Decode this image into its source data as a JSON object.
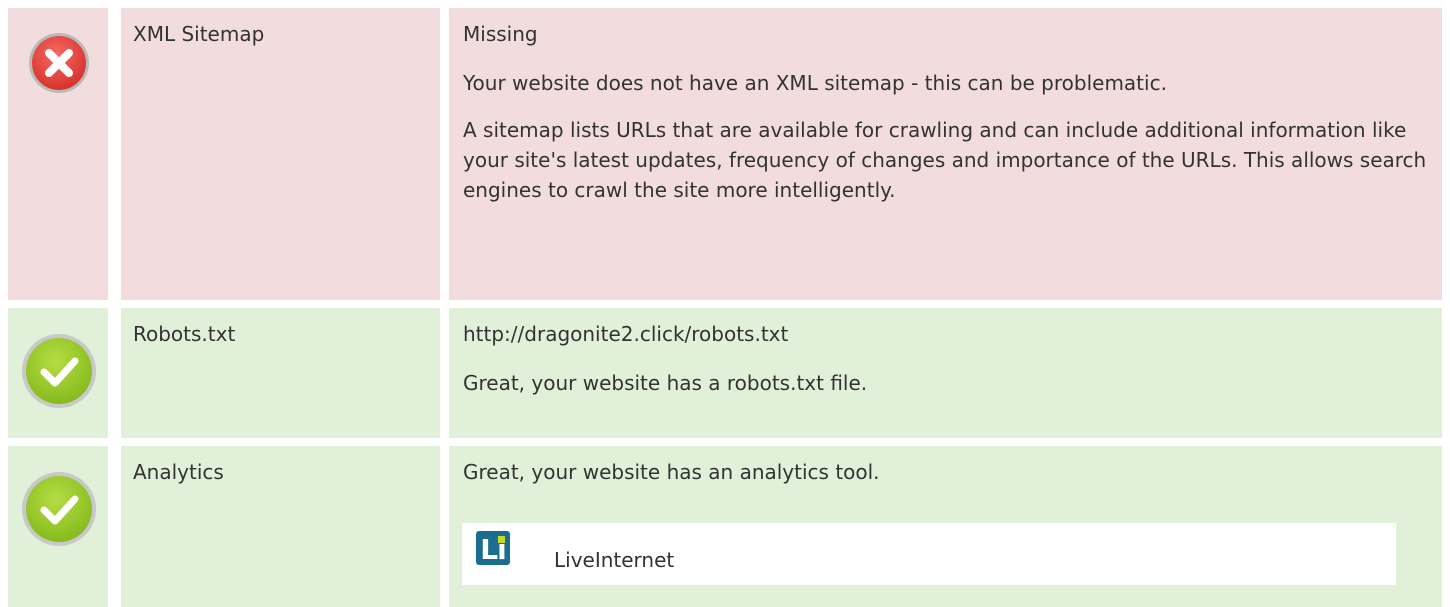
{
  "colors": {
    "fail_bg": "#f2dcde",
    "pass_bg": "#e0f0d9",
    "fail_icon": "#e8423d",
    "pass_icon": "#9ccd2b",
    "text": "#333333",
    "logo_bg": "#1b6e8e"
  },
  "rows": [
    {
      "status": "fail",
      "icon": "error-x-icon",
      "label": "XML Sitemap",
      "value": "Missing",
      "paragraphs": [
        "Your website does not have an XML sitemap - this can be problematic.",
        "A sitemap lists URLs that are available for crawling and can include additional information like your site's latest updates, frequency of changes and importance of the URLs. This allows search engines to crawl the site more intelligently."
      ]
    },
    {
      "status": "pass",
      "icon": "check-icon",
      "label": "Robots.txt",
      "value": "http://dragonite2.click/robots.txt",
      "paragraphs": [
        "Great, your website has a robots.txt file."
      ]
    },
    {
      "status": "pass",
      "icon": "check-icon",
      "label": "Analytics",
      "value": "Great, your website has an analytics tool.",
      "tools": [
        {
          "name": "LiveInternet",
          "logo_text": "Li",
          "icon": "liveinternet-logo-icon"
        }
      ]
    }
  ]
}
